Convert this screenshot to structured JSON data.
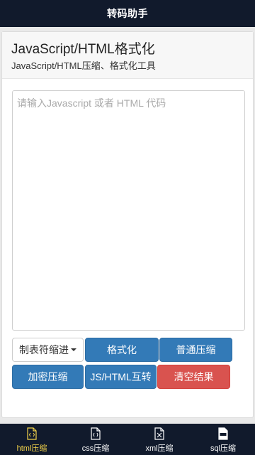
{
  "header": {
    "title": "转码助手"
  },
  "panel": {
    "title": "JavaScript/HTML格式化",
    "subtitle": "JavaScript/HTML压缩、格式化工具"
  },
  "editor": {
    "value": "",
    "placeholder": "请输入Javascript 或者 HTML 代码"
  },
  "buttons": {
    "indent_select": "制表符缩进",
    "format": "格式化",
    "normal_compress": "普通压缩",
    "encrypt_compress": "加密压缩",
    "js_html_convert": "JS/HTML互转",
    "clear_result": "清空结果"
  },
  "tabs": [
    {
      "label": "html压缩",
      "icon": "html-file-icon",
      "active": true
    },
    {
      "label": "css压缩",
      "icon": "css-file-icon",
      "active": false
    },
    {
      "label": "xml压缩",
      "icon": "xml-file-icon",
      "active": false
    },
    {
      "label": "sql压缩",
      "icon": "sql-file-icon",
      "active": false
    }
  ],
  "colors": {
    "header_bg": "#111a2c",
    "primary": "#337ab7",
    "danger": "#d9534f",
    "active_tab": "#f3d34a"
  }
}
